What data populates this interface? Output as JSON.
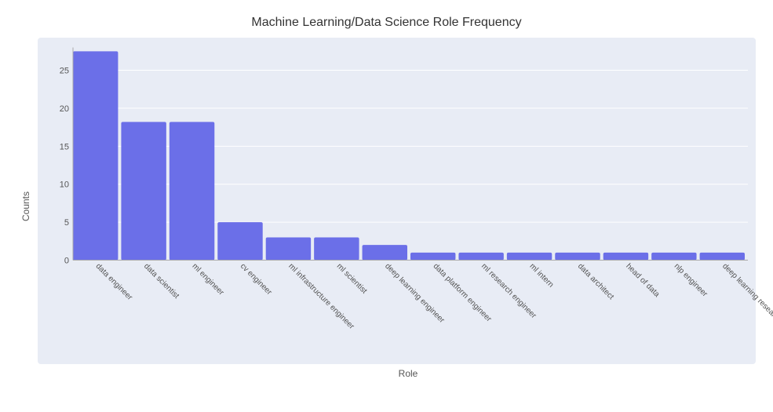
{
  "title": "Machine Learning/Data Science Role Frequency",
  "xAxisLabel": "Role",
  "yAxisLabel": "Counts",
  "barColor": "#6B6FE8",
  "bgColor": "#e8ecf5",
  "yTicks": [
    0,
    5,
    10,
    15,
    20,
    25
  ],
  "maxValue": 28,
  "bars": [
    {
      "label": "data engineer",
      "value": 27.5
    },
    {
      "label": "data scientist",
      "value": 18.2
    },
    {
      "label": "ml engineer",
      "value": 18.2
    },
    {
      "label": "cv engineer",
      "value": 5.0
    },
    {
      "label": "ml infrastructure engineer",
      "value": 3.0
    },
    {
      "label": "ml scientist",
      "value": 3.0
    },
    {
      "label": "deep learning engineer",
      "value": 2.0
    },
    {
      "label": "data platform engineer",
      "value": 1.0
    },
    {
      "label": "ml research engineer",
      "value": 1.0
    },
    {
      "label": "ml intern",
      "value": 1.0
    },
    {
      "label": "data architect",
      "value": 1.0
    },
    {
      "label": "head of data",
      "value": 1.0
    },
    {
      "label": "nlp engineer",
      "value": 1.0
    },
    {
      "label": "deep learning researcher",
      "value": 1.0
    }
  ]
}
